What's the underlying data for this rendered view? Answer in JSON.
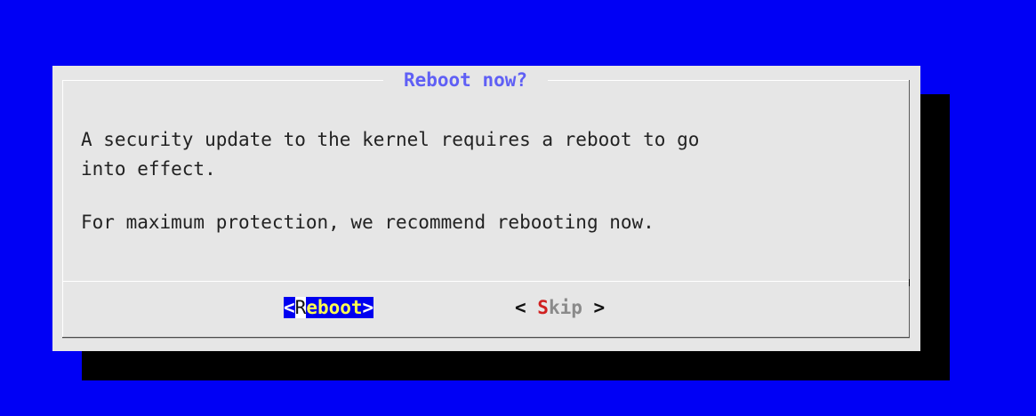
{
  "dialog": {
    "title": "Reboot now?",
    "message_line1": "A security update to the kernel requires a reboot to go\ninto effect.",
    "message_line2": "For maximum protection, we recommend rebooting now."
  },
  "buttons": {
    "reboot": {
      "open": "<",
      "hotkey": "R",
      "rest": "eboot",
      "close": ">",
      "selected": true
    },
    "skip": {
      "open": "< ",
      "hotkey": "S",
      "rest": "kip",
      "close": " >",
      "selected": false
    }
  },
  "colors": {
    "background": "#0000f5",
    "dialog_bg": "#e6e6e6",
    "title": "#5f5ff5",
    "selected_button_bg": "#0000f0",
    "selected_button_text": "#ffff50",
    "hotkey_unselected": "#d02020"
  }
}
